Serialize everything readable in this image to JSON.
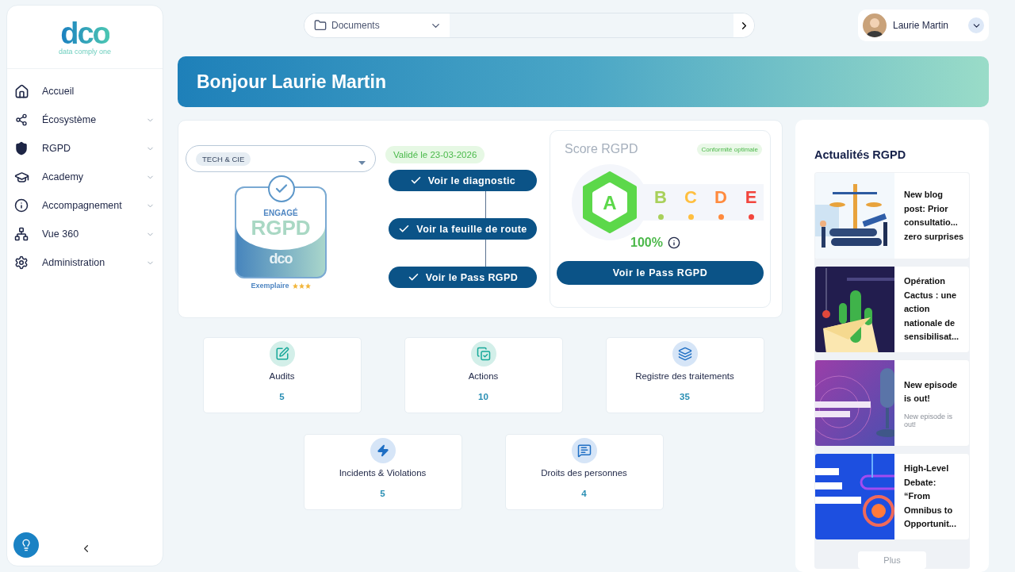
{
  "sidebar": {
    "logo": {
      "mark": "dco",
      "tagline": "data comply one"
    },
    "items": [
      {
        "label": "Accueil",
        "kind": "link"
      },
      {
        "label": "Écosystème",
        "kind": "group"
      },
      {
        "label": "RGPD",
        "kind": "group"
      },
      {
        "label": "Academy",
        "kind": "group"
      },
      {
        "label": "Accompagnement",
        "kind": "group"
      },
      {
        "label": "Vue 360",
        "kind": "group"
      },
      {
        "label": "Administration",
        "kind": "group"
      }
    ]
  },
  "topbar": {
    "folder": "Documents",
    "user": "Laurie Martin"
  },
  "banner": {
    "title": "Bonjour Laurie Martin"
  },
  "company": {
    "tag": "TECH & CIE",
    "validated": "Validé le 23-03-2026"
  },
  "badge": {
    "top": "ENGAGÉ",
    "main": "RGPD",
    "mark": "dco",
    "caption": "Exemplaire",
    "stars": 3
  },
  "steps": [
    {
      "label": "Voir le diagnostic",
      "done": true
    },
    {
      "label": "Voir la feuille de route",
      "done": true
    },
    {
      "label": "Voir le Pass RGPD",
      "done": true
    }
  ],
  "score": {
    "title": "Score RGPD",
    "status": "Conformité optimale",
    "grades": [
      {
        "label": "A",
        "color": "#5cd84a",
        "selected": true
      },
      {
        "label": "B",
        "color": "#a8d05a",
        "selected": false
      },
      {
        "label": "C",
        "color": "#ffbf3f",
        "selected": false
      },
      {
        "label": "D",
        "color": "#ff8a3d",
        "selected": false
      },
      {
        "label": "E",
        "color": "#f2453d",
        "selected": false
      }
    ],
    "percent": "100%",
    "button": "Voir le Pass RGPD"
  },
  "stats": [
    {
      "label": "Audits",
      "value": "5"
    },
    {
      "label": "Actions",
      "value": "10"
    },
    {
      "label": "Registre des traitements",
      "value": "35"
    },
    {
      "label": "Incidents & Violations",
      "value": "5"
    },
    {
      "label": "Droits des personnes",
      "value": "4"
    }
  ],
  "news": {
    "title": "Actualités RGPD",
    "items": [
      {
        "title": "New blog post: Prior consultatio... zero surprises"
      },
      {
        "title": "Opération Cactus : une action nationale de sensibilisat..."
      },
      {
        "title": "New episode is out!",
        "summary": "New episode is out!"
      },
      {
        "title": "High-Level Debate: “From Omnibus to Opportunit..."
      }
    ],
    "more": "Plus"
  }
}
